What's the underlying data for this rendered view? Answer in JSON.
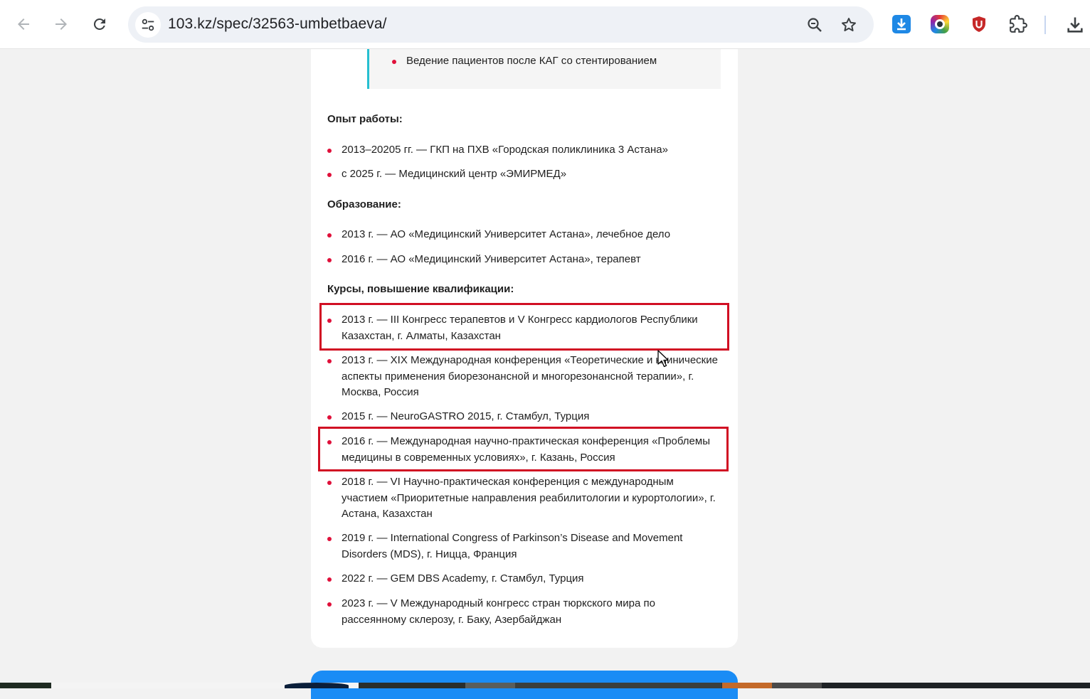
{
  "browser": {
    "url": "103.kz/spec/32563-umbetbaeva/"
  },
  "specialization": {
    "items": [
      "Ведение пациентов после КАГ со стентированием"
    ]
  },
  "experience": {
    "title": "Опыт работы:",
    "items": [
      "2013–20205 гг. — ГКП на ПХВ «Городская поликлиника 3 Астана»",
      "с 2025 г. — Медицинский центр «ЭМИРМЕД»"
    ]
  },
  "education": {
    "title": "Образование:",
    "items": [
      "2013 г. — АО «Медицинский Университет Астана», лечебное дело",
      "2016 г. — АО «Медицинский Университет Астана», терапевт"
    ]
  },
  "courses": {
    "title": "Курсы, повышение квалификации:",
    "items": [
      {
        "line1": "2013 г. — III Конгресс терапевтов и V Конгресс кардиологов Республики",
        "line2": "Казахстан, г. Алматы, Казахстан",
        "line3": ""
      },
      {
        "line1": "2013 г. — XIX Международная конференция «Теоретические и клинические",
        "line2": "аспекты применения биорезонансной и многорезонансной терапии», г.",
        "line3": "Москва, Россия"
      },
      {
        "line1": "2015 г. — NeuroGASTRO 2015, г. Стамбул, Турция",
        "line2": "",
        "line3": ""
      },
      {
        "line1": "2016 г. — Международная научно-практическая конференция «Проблемы",
        "line2": "медицины в современных условиях», г. Казань, Россия",
        "line3": ""
      },
      {
        "line1": "2018 г. — VI Научно-практическая конференция с международным",
        "line2": "участием «Приоритетные направления реабилитологии и курортологии», г.",
        "line3": "Астана, Казахстан"
      },
      {
        "line1": "2019 г. — International Congress of Parkinson’s Disease and Movement",
        "line2": "Disorders (MDS), г. Ницца, Франция",
        "line3": ""
      },
      {
        "line1": "2022 г. — GEM DBS Academy, г. Стамбул, Турция",
        "line2": "",
        "line3": ""
      },
      {
        "line1": "2023 г. — V Международный конгресс стран тюркского мира по",
        "line2": "рассеянному склерозу, г. Баку, Азербайджан",
        "line3": ""
      }
    ]
  },
  "colors": {
    "bullet": "#e0103a",
    "highlight_border": "#d10f23",
    "accent_border": "#26bfd0",
    "cta": "#1a8cf5"
  }
}
